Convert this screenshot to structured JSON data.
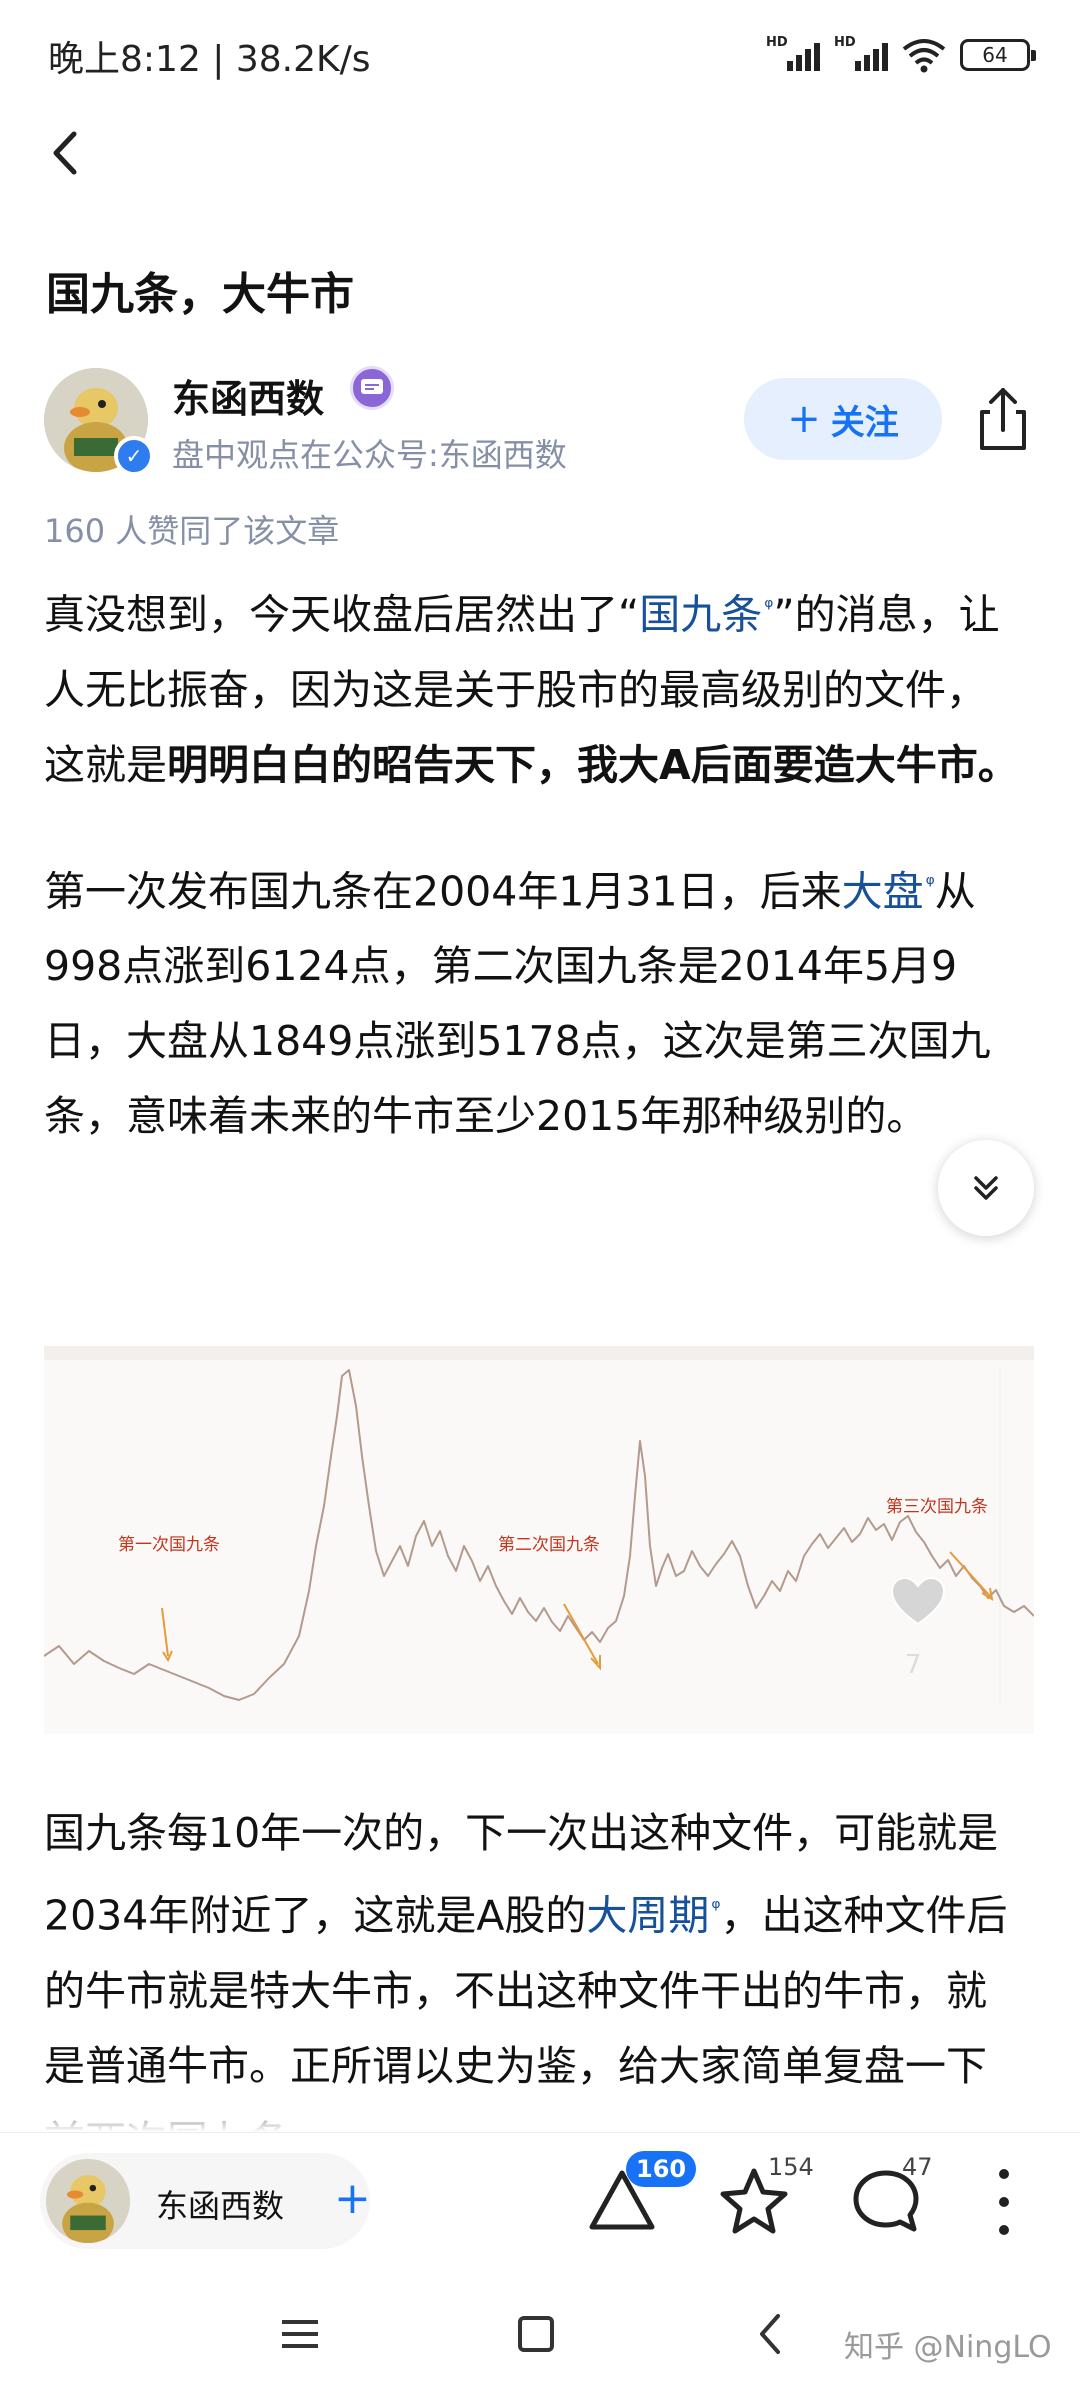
{
  "status": {
    "time": "晚上8:12 | 38.2K/s",
    "hd1": "HD",
    "hd2": "HD",
    "battery": "64"
  },
  "article": {
    "title": "国九条，大牛市",
    "author_name": "东函西数",
    "author_bio": "盘中观点在公众号:东函西数",
    "follow_label": "关注",
    "likes_line": "160 人赞同了该文章",
    "p1": {
      "t1": "真没想到，今天收盘后居然出了“",
      "link1": "国九条",
      "t2": "”的消息，让人无比振奋，因为这是关于股市的最高级别的文件，这就是",
      "bold": "明明白白的昭告天下，我大A后面要造大牛市。"
    },
    "p2": {
      "t1": "第一次发布国九条在2004年1月31日，后来",
      "link": "大盘",
      "t2": "从998点涨到6124点，第二次国九条是2014年5月9日，大盘从1849点涨到5178点，这次是第三次国九条，意味着未来的牛市至少2015年那种级别的。"
    },
    "p3": {
      "t1": "国九条每10年一次的，下一次出这种文件，可能就是2034年附近了，这就是A股的",
      "link": "大周期",
      "t2": "，出这种文件后的牛市就是特大牛市，不出这种文件干出的牛市，就是普通牛市。正所谓以史为鉴，给大家简单复盘一下前两次国九条"
    },
    "search_icon_glyph": "ᵠ"
  },
  "chart_image": {
    "labels": {
      "first": "第一次国九条",
      "second": "第二次国九条",
      "third": "第三次国九条"
    },
    "heart_count": "7"
  },
  "actionbar": {
    "author_name": "东函西数",
    "plus": "+",
    "vote_count": "160",
    "favorite_count": "154",
    "comment_count": "47"
  },
  "watermark": "知乎 @NingLO",
  "colors": {
    "link": "#175199",
    "accent": "#1772f6",
    "annotation": "#c4351d"
  }
}
